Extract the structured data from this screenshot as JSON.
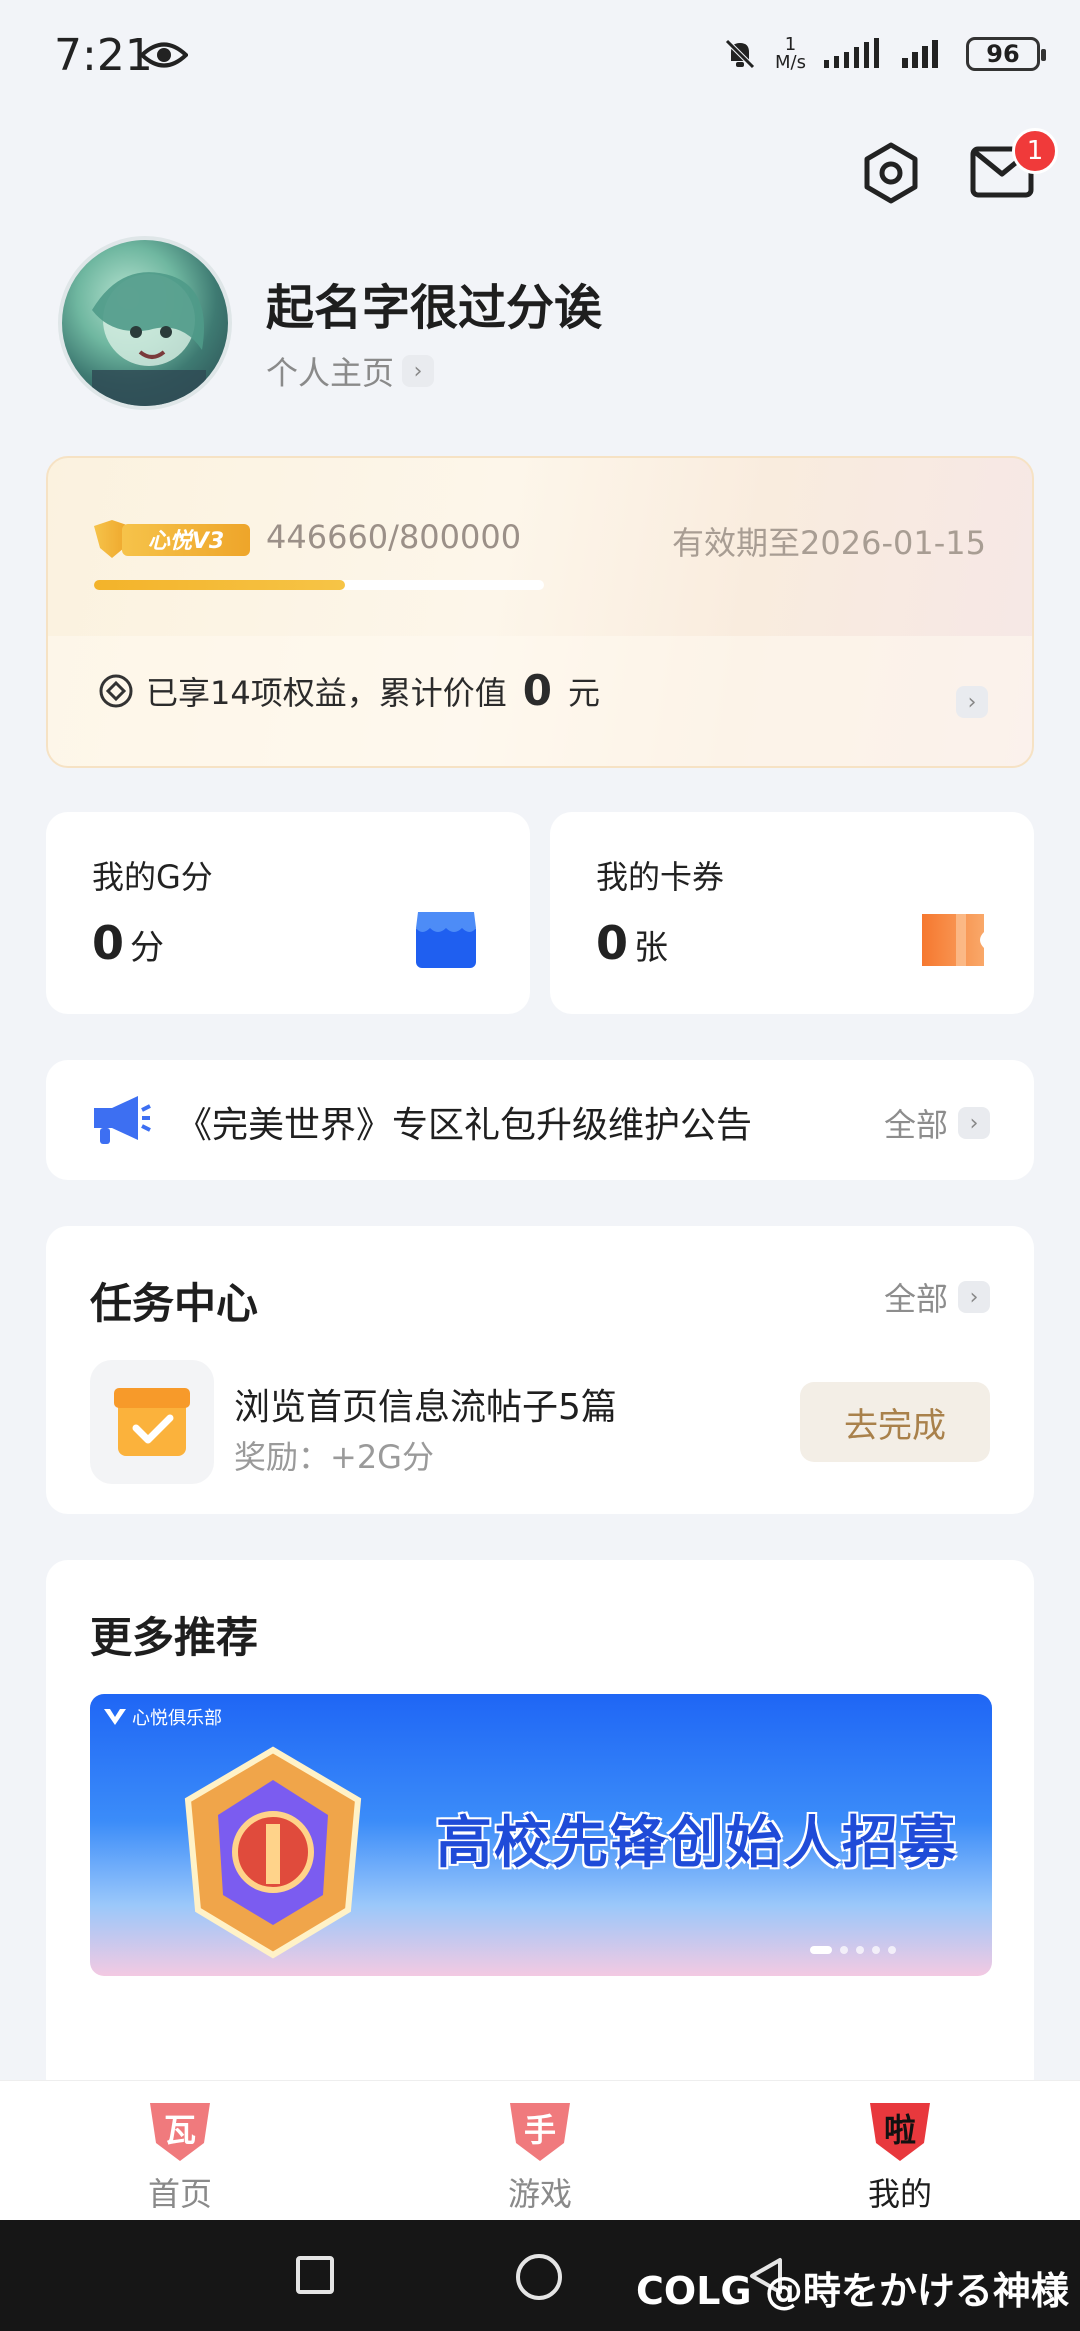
{
  "status_bar": {
    "time": "7:21",
    "speed_value": "1",
    "speed_unit": "M/s",
    "battery": "96"
  },
  "header": {
    "mail_badge": "1"
  },
  "profile": {
    "name": "起名字很过分诶",
    "homepage_link": "个人主页"
  },
  "vip": {
    "level_badge": "心悦V3",
    "points": "446660/800000",
    "progress_fraction": 0.558,
    "expire": "有效期至2026-01-15",
    "benefit_prefix": "已享14项权益，累计价值",
    "benefit_value": "0",
    "benefit_unit": "元"
  },
  "gpoints": {
    "title": "我的G分",
    "value": "0",
    "unit": "分"
  },
  "coupons": {
    "title": "我的卡券",
    "value": "0",
    "unit": "张"
  },
  "notice": {
    "text": "《完美世界》专区礼包升级维护公告",
    "more": "全部"
  },
  "tasks": {
    "title": "任务中心",
    "more": "全部",
    "item": {
      "title": "浏览首页信息流帖子5篇",
      "reward": "奖励：+2G分",
      "action": "去完成"
    }
  },
  "recommend": {
    "title": "更多推荐",
    "banner_club": "心悦俱乐部",
    "banner_text": "高校先锋创始人招募"
  },
  "tabs": [
    {
      "label": "首页",
      "icon_text": "瓦"
    },
    {
      "label": "游戏",
      "icon_text": "手"
    },
    {
      "label": "我的",
      "icon_text": "啦"
    }
  ],
  "watermark": "COLG @時をかける神様",
  "colors": {
    "accent_red": "#e8383d",
    "gold": "#f3b32a",
    "brand_blue": "#2f6bf6"
  }
}
